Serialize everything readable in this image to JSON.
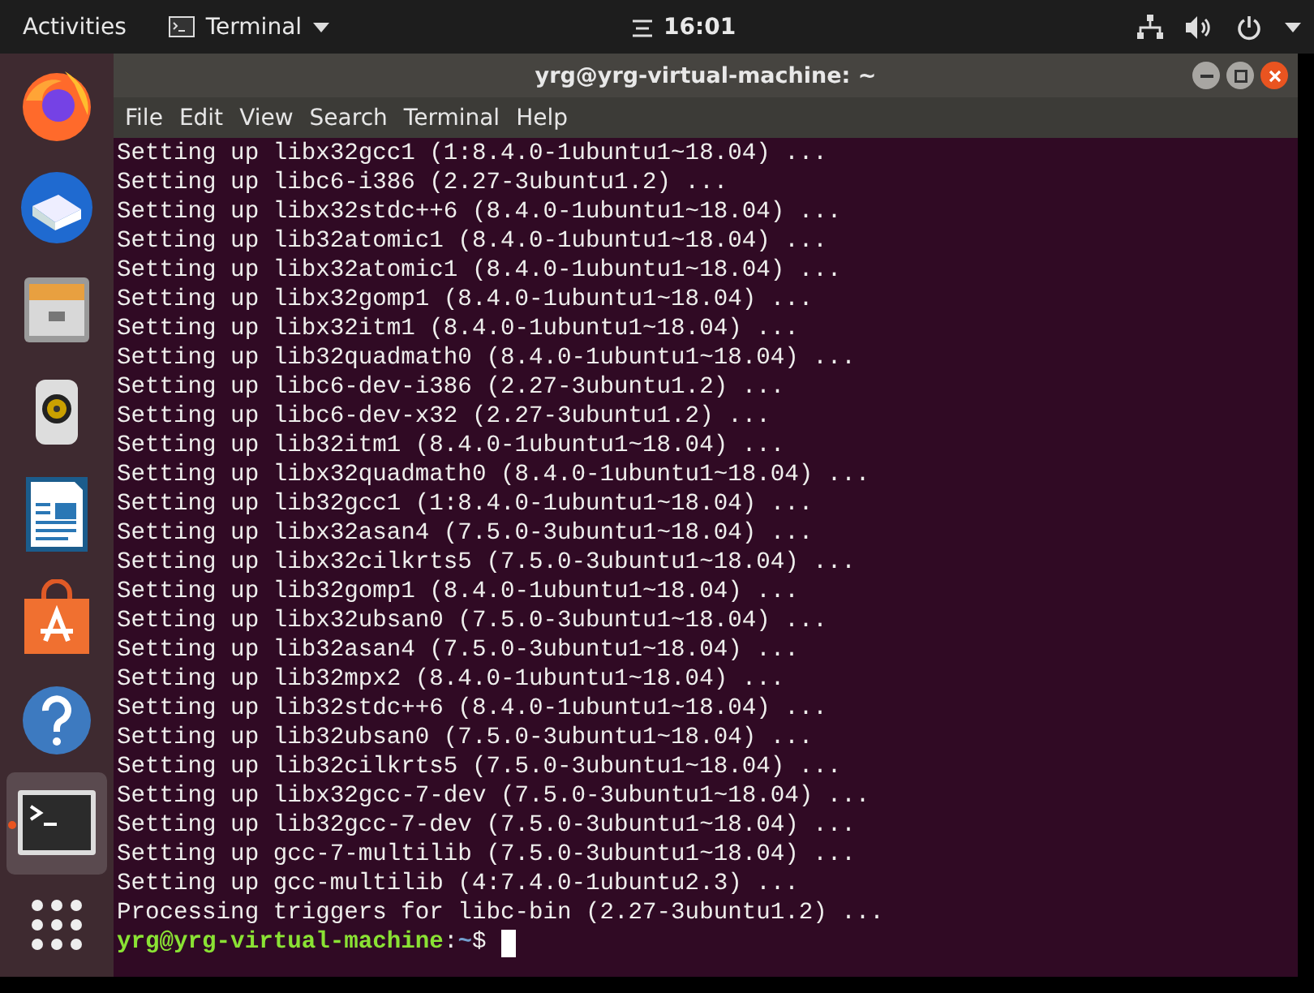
{
  "top_bar": {
    "activities": "Activities",
    "app_menu": "Terminal",
    "clock": "16:01"
  },
  "dock": {
    "items": [
      {
        "kind": "firefox",
        "selected": false
      },
      {
        "kind": "thunderbird",
        "selected": false
      },
      {
        "kind": "files",
        "selected": false
      },
      {
        "kind": "rhythmbox",
        "selected": false
      },
      {
        "kind": "writer",
        "selected": false
      },
      {
        "kind": "software",
        "selected": false
      },
      {
        "kind": "help",
        "selected": false
      },
      {
        "kind": "terminal",
        "selected": true
      },
      {
        "kind": "apps",
        "selected": false
      }
    ]
  },
  "window": {
    "title": "yrg@yrg-virtual-machine: ~",
    "menu": [
      "File",
      "Edit",
      "View",
      "Search",
      "Terminal",
      "Help"
    ],
    "lines": [
      "Setting up libx32gcc1 (1:8.4.0-1ubuntu1~18.04) ...",
      "Setting up libc6-i386 (2.27-3ubuntu1.2) ...",
      "Setting up libx32stdc++6 (8.4.0-1ubuntu1~18.04) ...",
      "Setting up lib32atomic1 (8.4.0-1ubuntu1~18.04) ...",
      "Setting up libx32atomic1 (8.4.0-1ubuntu1~18.04) ...",
      "Setting up libx32gomp1 (8.4.0-1ubuntu1~18.04) ...",
      "Setting up libx32itm1 (8.4.0-1ubuntu1~18.04) ...",
      "Setting up lib32quadmath0 (8.4.0-1ubuntu1~18.04) ...",
      "Setting up libc6-dev-i386 (2.27-3ubuntu1.2) ...",
      "Setting up libc6-dev-x32 (2.27-3ubuntu1.2) ...",
      "Setting up lib32itm1 (8.4.0-1ubuntu1~18.04) ...",
      "Setting up libx32quadmath0 (8.4.0-1ubuntu1~18.04) ...",
      "Setting up lib32gcc1 (1:8.4.0-1ubuntu1~18.04) ...",
      "Setting up libx32asan4 (7.5.0-3ubuntu1~18.04) ...",
      "Setting up libx32cilkrts5 (7.5.0-3ubuntu1~18.04) ...",
      "Setting up lib32gomp1 (8.4.0-1ubuntu1~18.04) ...",
      "Setting up libx32ubsan0 (7.5.0-3ubuntu1~18.04) ...",
      "Setting up lib32asan4 (7.5.0-3ubuntu1~18.04) ...",
      "Setting up lib32mpx2 (8.4.0-1ubuntu1~18.04) ...",
      "Setting up lib32stdc++6 (8.4.0-1ubuntu1~18.04) ...",
      "Setting up lib32ubsan0 (7.5.0-3ubuntu1~18.04) ...",
      "Setting up lib32cilkrts5 (7.5.0-3ubuntu1~18.04) ...",
      "Setting up libx32gcc-7-dev (7.5.0-3ubuntu1~18.04) ...",
      "Setting up lib32gcc-7-dev (7.5.0-3ubuntu1~18.04) ...",
      "Setting up gcc-7-multilib (7.5.0-3ubuntu1~18.04) ...",
      "Setting up gcc-multilib (4:7.4.0-1ubuntu2.3) ...",
      "Processing triggers for libc-bin (2.27-3ubuntu1.2) ..."
    ],
    "prompt": {
      "user_host": "yrg@yrg-virtual-machine",
      "separator": ":",
      "path": "~",
      "symbol": "$"
    }
  }
}
